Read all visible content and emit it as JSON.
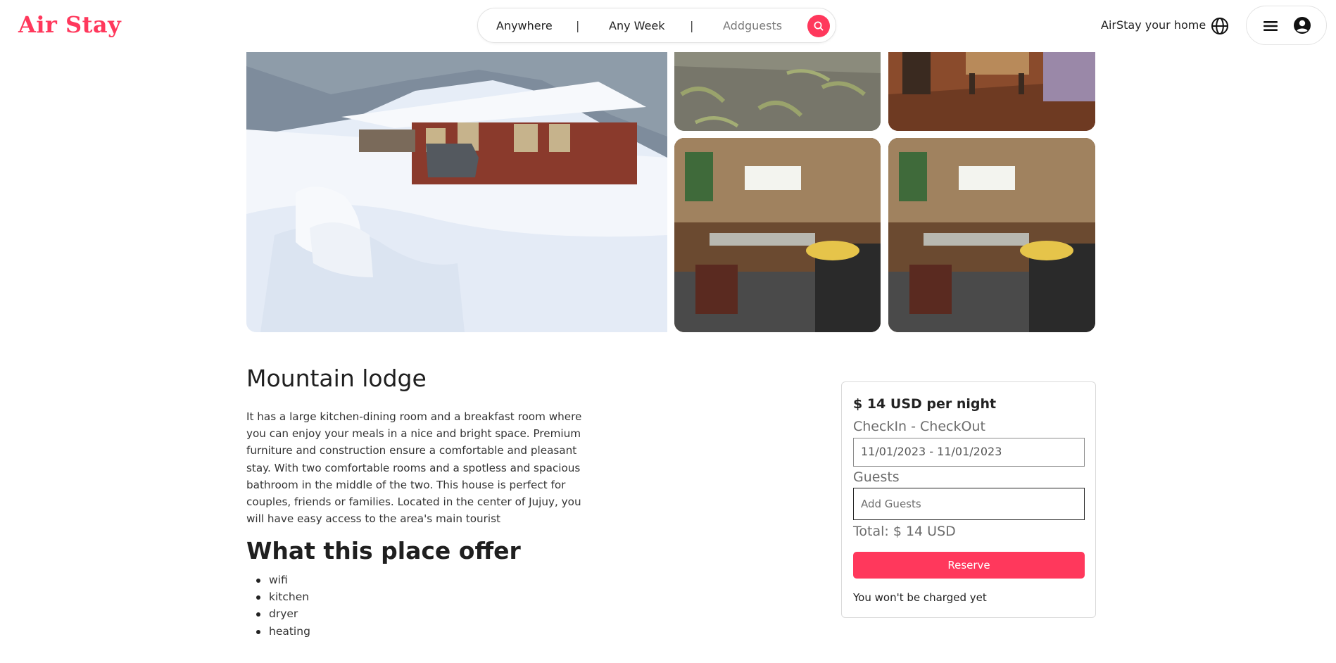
{
  "header": {
    "logo": "Air Stay",
    "search": {
      "location": "Anywhere",
      "separator": "|",
      "dates": "Any Week",
      "guests": "Addguests"
    },
    "host_link": "AirStay your home"
  },
  "listing": {
    "title": "Mountain lodge",
    "description": "It has a large kitchen-dining room and a breakfast room where you can enjoy your meals in a nice and bright space. Premium furniture and construction ensure a comfortable and pleasant stay. With two comfortable rooms and a spotless and spacious bathroom in the middle of the two. This house is perfect for couples, friends or families. Located in the center of Jujuy, you will have easy access to the area's main tourist",
    "offers_title": "What this place offer",
    "offers": [
      "wifi",
      "kitchen",
      "dryer",
      "heating"
    ]
  },
  "booking": {
    "price": "$ 14 USD per night",
    "dates_label": "CheckIn - CheckOut",
    "dates_value": "11/01/2023 - 11/01/2023",
    "guests_label": "Guests",
    "guests_placeholder": "Add Guests",
    "total": "Total: $ 14 USD",
    "reserve_label": "Reserve",
    "note": "You won't be charged yet"
  },
  "colors": {
    "brand": "#ff385c",
    "text": "#212529",
    "muted": "#6c6c6c"
  },
  "icons": [
    "search-icon",
    "globe-icon",
    "hamburger-menu-icon",
    "user-avatar-icon"
  ]
}
